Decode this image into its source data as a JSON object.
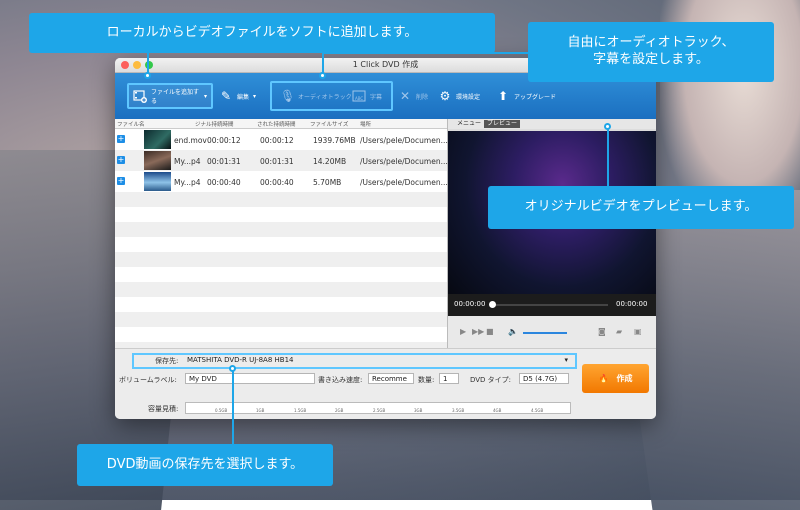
{
  "window": {
    "title": "1 Click DVD 作成"
  },
  "toolbar": {
    "add_file": "ファイルを追加する",
    "edit": "編集",
    "audio_track": "オーディオトラック",
    "subtitle": "字幕",
    "delete": "削除",
    "preferences": "環境設定",
    "upgrade": "アップグレード"
  },
  "filelist": {
    "headers": [
      "ファイル名",
      "ジナル持続時間",
      "された持続時間",
      "ファイルサイズ",
      "場所"
    ],
    "rows": [
      {
        "name": "end.mov",
        "orig_duration": "00:00:12",
        "new_duration": "00:00:12",
        "size": "1939.76MB",
        "location": "/Users/pele/Documen..."
      },
      {
        "name": "My...p4",
        "orig_duration": "00:01:31",
        "new_duration": "00:01:31",
        "size": "14.20MB",
        "location": "/Users/pele/Documen..."
      },
      {
        "name": "My...p4",
        "orig_duration": "00:00:40",
        "new_duration": "00:00:40",
        "size": "5.70MB",
        "location": "/Users/pele/Documen..."
      }
    ]
  },
  "preview": {
    "tab_menu": "メニュー",
    "tab_preview": "プレビュー",
    "time_start": "00:00:00",
    "time_end": "00:00:00"
  },
  "bottom": {
    "dest_label": "保存先:",
    "dest_value": "MATSHITA DVD-R   UJ-8A8 HB14",
    "volume_label": "ボリュームラベル:",
    "volume_value": "My DVD",
    "speed_label": "書き込み速度:",
    "speed_value": "Recomme",
    "qty_label": "数量:",
    "qty_value": "1",
    "dvd_type_label": "DVD タイプ:",
    "dvd_type_value": "D5 (4.7G)",
    "capacity_label": "容量見積:",
    "ruler_ticks": [
      "0.5GB",
      "1GB",
      "1.5GB",
      "2GB",
      "2.5GB",
      "3GB",
      "3.5GB",
      "4GB",
      "4.5GB"
    ],
    "create_label": "作成"
  },
  "callouts": {
    "add_local": "ローカルからビデオファイルをソフトに追加します。",
    "audio_sub": "自由にオーディオトラック、\n字幕を設定します。",
    "preview": "オリジナルビデオをプレビューします。",
    "dest": "DVD動画の保存先を選択します。"
  },
  "colors": {
    "accent": "#1ea6e8",
    "toolbar": "#1b6fc0",
    "create": "#f27800"
  }
}
